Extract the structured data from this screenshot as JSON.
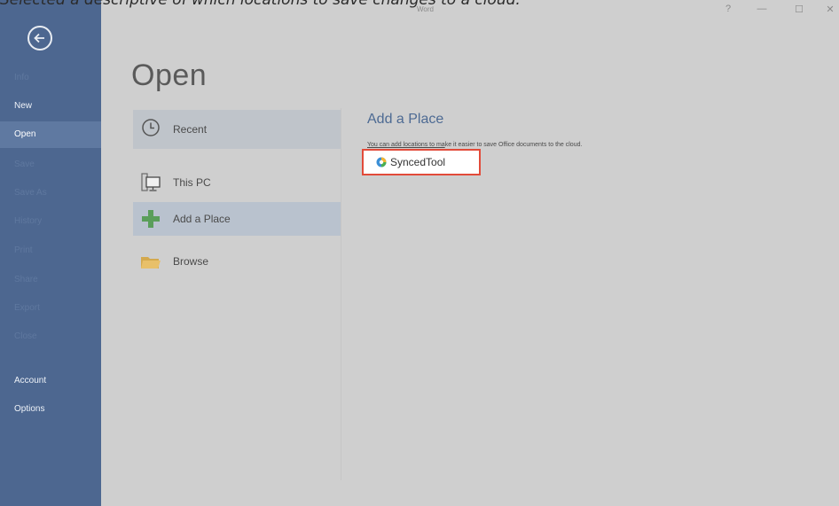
{
  "caption": "Selected a descriptive of which locations to save changes to a cloud.",
  "window": {
    "title": "Word",
    "help": "?",
    "minimize": "—",
    "maximize": "☐",
    "close": "✕"
  },
  "sidebar": {
    "items": [
      {
        "label": "Info",
        "state": "faint"
      },
      {
        "label": "New",
        "state": "normal"
      },
      {
        "label": "Open",
        "state": "active"
      },
      {
        "label": "Save",
        "state": "faint"
      },
      {
        "label": "Save As",
        "state": "faint"
      },
      {
        "label": "History",
        "state": "faint"
      },
      {
        "label": "Print",
        "state": "faint"
      },
      {
        "label": "Share",
        "state": "faint"
      },
      {
        "label": "Export",
        "state": "faint"
      },
      {
        "label": "Close",
        "state": "faint"
      },
      {
        "label": "Account",
        "state": "normal"
      },
      {
        "label": "Options",
        "state": "normal"
      }
    ]
  },
  "main": {
    "title": "Open",
    "places": [
      {
        "label": "Recent",
        "icon": "clock-icon"
      },
      {
        "label": "This PC",
        "icon": "computer-icon"
      },
      {
        "label": "Add a Place",
        "icon": "plus-icon"
      },
      {
        "label": "Browse",
        "icon": "folder-icon"
      }
    ],
    "panel": {
      "title": "Add a Place",
      "description_underlined": "You can add locations to ma",
      "description_rest": "ke it easier to save Office documents to the cloud.",
      "service": {
        "label": "SyncedTool",
        "icon": "synced-tool-icon"
      }
    }
  },
  "colors": {
    "sidebar": "#4d6790",
    "highlight_border": "#e24b3a",
    "panel_title": "#4d6a93"
  }
}
